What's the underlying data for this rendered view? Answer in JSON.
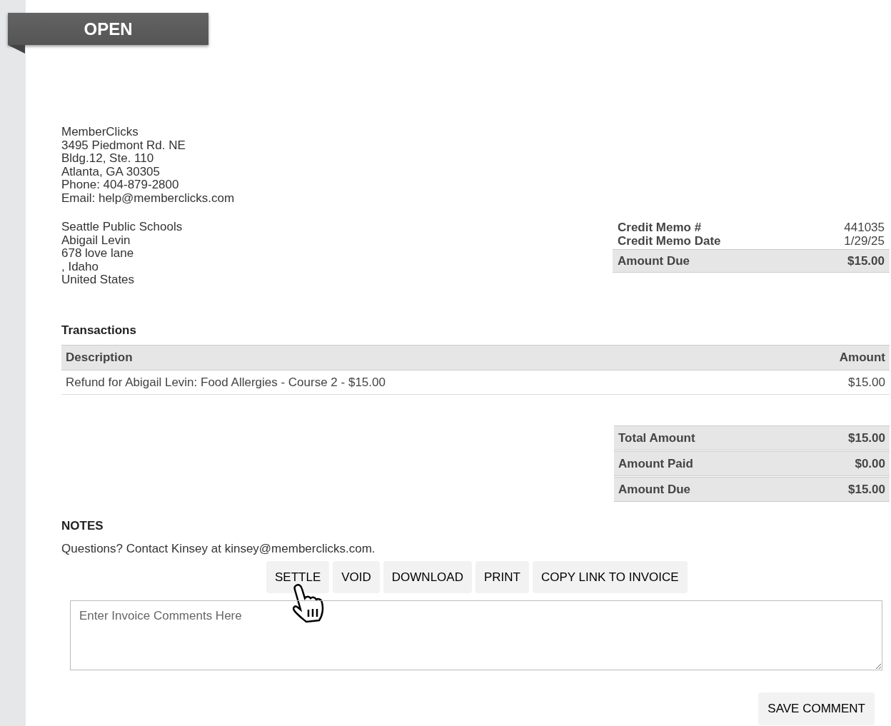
{
  "status_ribbon": "OPEN",
  "sender": [
    "MemberClicks",
    "3495 Piedmont Rd. NE",
    "Bldg.12, Ste. 110",
    "Atlanta, GA 30305",
    "Phone: 404-879-2800",
    "Email: help@memberclicks.com"
  ],
  "recipient": [
    "Seattle Public Schools",
    "Abigail Levin",
    "678 love lane",
    ", Idaho",
    "United States"
  ],
  "memo_info": [
    {
      "label": "Credit Memo #",
      "value": "441035",
      "highlighted": false
    },
    {
      "label": "Credit Memo Date",
      "value": "1/29/25",
      "highlighted": false
    },
    {
      "label": "Amount Due",
      "value": "$15.00",
      "highlighted": true
    }
  ],
  "transactions": {
    "title": "Transactions",
    "columns": [
      "Description",
      "Amount"
    ],
    "rows": [
      [
        "Refund for Abigail Levin: Food Allergies - Course 2 - $15.00",
        "$15.00"
      ]
    ]
  },
  "totals": [
    {
      "label": "Total Amount",
      "value": "$15.00"
    },
    {
      "label": "Amount Paid",
      "value": "$0.00"
    },
    {
      "label": "Amount Due",
      "value": "$15.00"
    }
  ],
  "notes": {
    "title": "NOTES",
    "text": "Questions? Contact Kinsey at kinsey@memberclicks.com."
  },
  "actions": [
    "SETTLE",
    "VOID",
    "DOWNLOAD",
    "PRINT",
    "COPY LINK TO INVOICE"
  ],
  "comment_field": {
    "placeholder": "Enter Invoice Comments Here"
  },
  "save_button": "SAVE COMMENT"
}
